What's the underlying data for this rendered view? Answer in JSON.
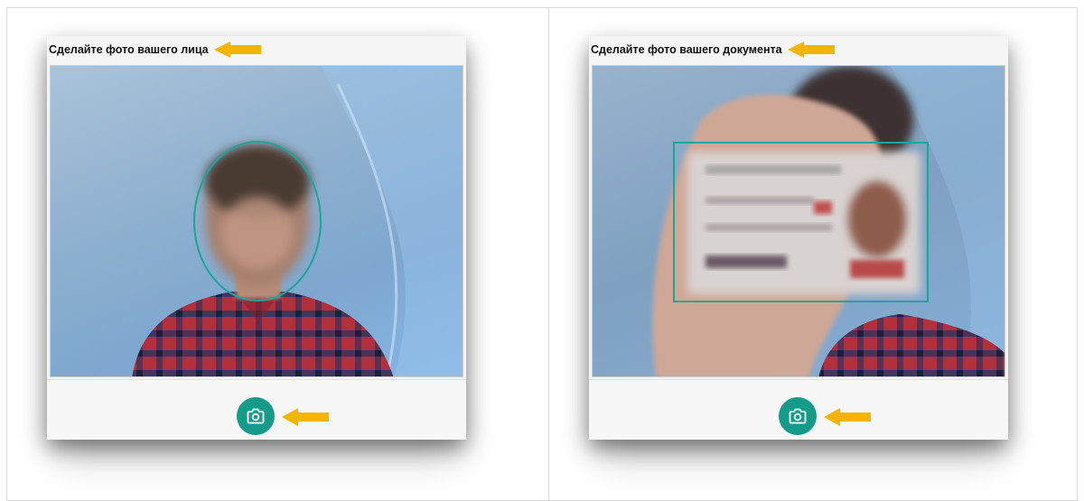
{
  "panels": [
    {
      "title": "Сделайте фото вашего лица",
      "frame_shape": "oval",
      "capture_icon": "camera-icon"
    },
    {
      "title": "Сделайте фото вашего документа",
      "frame_shape": "rectangle",
      "capture_icon": "camera-icon"
    }
  ],
  "colors": {
    "accent": "#149b89",
    "arrow": "#f5b400",
    "frame_guide": "#1ea596"
  },
  "annotation_icon": "arrow-left-icon"
}
